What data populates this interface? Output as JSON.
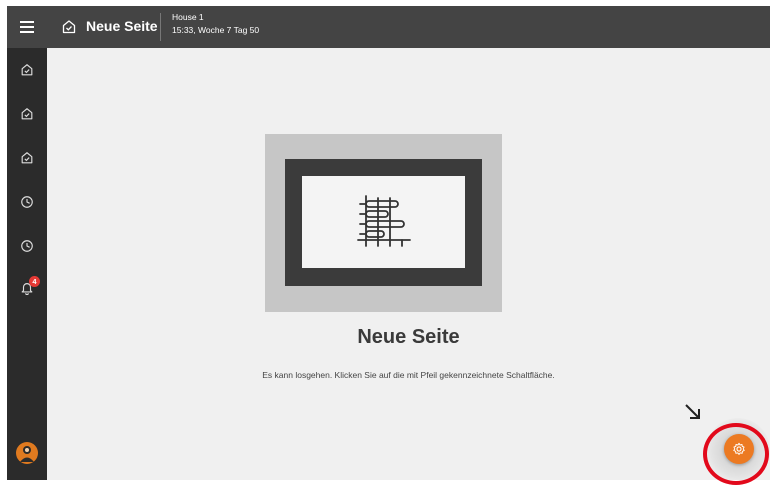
{
  "header": {
    "title": "Neue Seite",
    "house": "House 1",
    "time": "15:33, Woche 7 Tag 50"
  },
  "sidebar": {
    "items": [
      {
        "icon": "page-icon"
      },
      {
        "icon": "page-icon"
      },
      {
        "icon": "page-icon"
      },
      {
        "icon": "clock-icon"
      },
      {
        "icon": "clock-icon"
      },
      {
        "icon": "bell-icon",
        "badge": "4"
      }
    ]
  },
  "main": {
    "heading": "Neue Seite",
    "subtitle": "Es kann losgehen. Klicken Sie auf die mit Pfeil gekennzeichnete Schaltfläche."
  },
  "fab": {
    "icon": "gear-icon"
  },
  "colors": {
    "topbar": "#444444",
    "sidebar": "#2b2b2b",
    "content_bg": "#f0f0f0",
    "accent": "#ec7a22",
    "badge": "#e53935",
    "highlight": "#e2091b"
  }
}
